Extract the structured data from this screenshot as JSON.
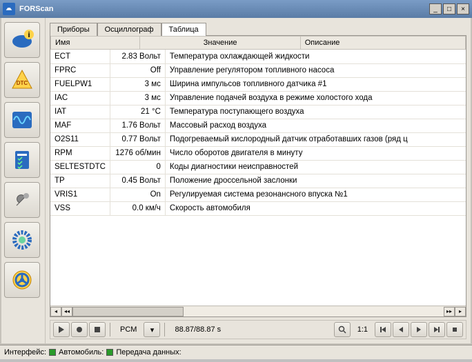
{
  "app": {
    "title": "FORScan"
  },
  "tabs": [
    {
      "label": "Приборы"
    },
    {
      "label": "Осциллограф"
    },
    {
      "label": "Таблица"
    }
  ],
  "columns": {
    "c1": "Имя",
    "c2": "Значение",
    "c3": "Описание"
  },
  "rows": [
    {
      "name": "ECT",
      "value": "2.83 Вольт",
      "desc": "Температура охлаждающей жидкости"
    },
    {
      "name": "FPRC",
      "value": "Off",
      "desc": "Управление регулятором топливного насоса"
    },
    {
      "name": "FUELPW1",
      "value": "3 мс",
      "desc": "Ширина импульсов топливного датчика #1"
    },
    {
      "name": "IAC",
      "value": "3 мс",
      "desc": "Управление подачей воздуха в режиме холостого хода"
    },
    {
      "name": "IAT",
      "value": "21 °C",
      "desc": "Температура поступающего воздуха"
    },
    {
      "name": "MAF",
      "value": "1.76 Вольт",
      "desc": "Массовый расход воздуха"
    },
    {
      "name": "O2S11",
      "value": "0.77 Вольт",
      "desc": "Подогреваемый кислородный датчик отработавших газов (ряд ц"
    },
    {
      "name": "RPM",
      "value": "1276 об/мин",
      "desc": "Число оборотов двигателя в минуту"
    },
    {
      "name": "SELTESTDTC",
      "value": "0",
      "desc": "Коды диагностики неисправностей"
    },
    {
      "name": "TP",
      "value": "0.45 Вольт",
      "desc": "Положение дроссельной заслонки"
    },
    {
      "name": "VRIS1",
      "value": "On",
      "desc": "Регулируемая система резонансного впуска №1"
    },
    {
      "name": "VSS",
      "value": "0.0 км/ч",
      "desc": "Скорость автомобиля"
    }
  ],
  "toolbar": {
    "module": "PCM",
    "time": "88.87/88.87 s",
    "zoom": "1:1"
  },
  "status": {
    "s1": "Интерфейс:",
    "s2": "Автомобиль:",
    "s3": "Передача данных:"
  }
}
